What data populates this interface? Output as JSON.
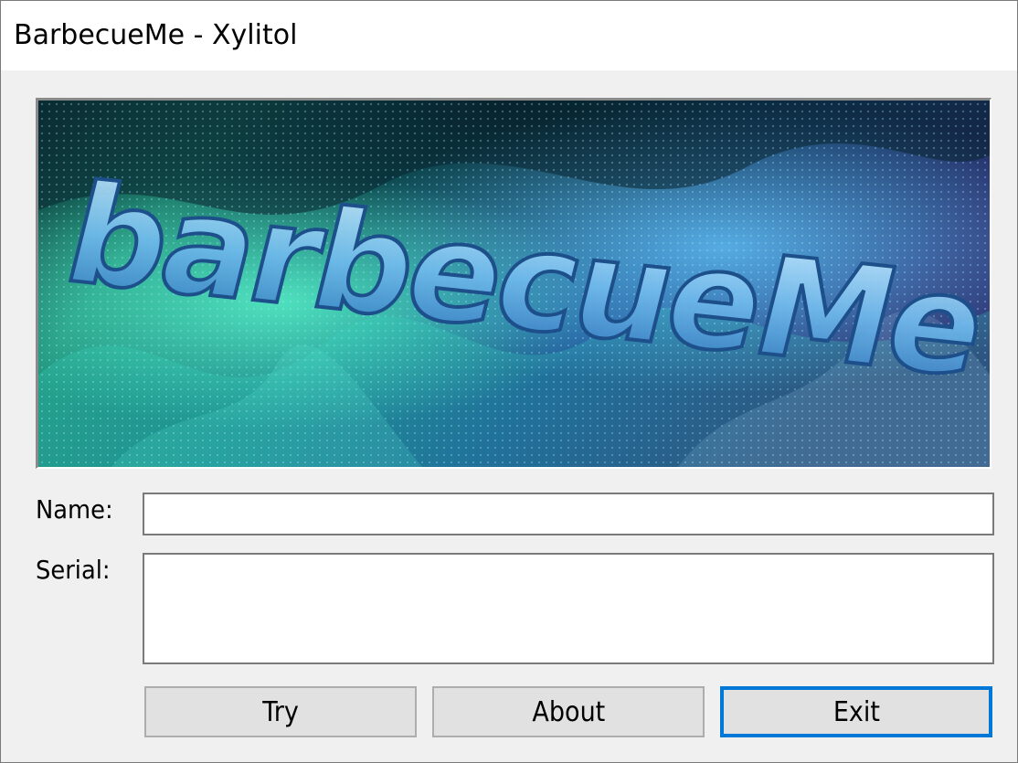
{
  "window": {
    "title": "BarbecueMe - Xylitol"
  },
  "banner": {
    "logo_text": "barbecueMe",
    "colors": {
      "dark": "#0b1a22",
      "teal": "#2fd7b5",
      "cyan": "#39b8e6",
      "blue": "#2a5fbf",
      "purple": "#3a2a7a",
      "letter_fill": "#7fc9ef"
    }
  },
  "form": {
    "name_label": "Name:",
    "name_value": "",
    "serial_label": "Serial:",
    "serial_value": ""
  },
  "buttons": {
    "try_label": "Try",
    "about_label": "About",
    "exit_label": "Exit",
    "default_button": "exit"
  },
  "colors": {
    "window_bg": "#f0f0f0",
    "titlebar_bg": "#ffffff",
    "button_bg": "#e1e1e1",
    "focus_border": "#0078d7"
  }
}
